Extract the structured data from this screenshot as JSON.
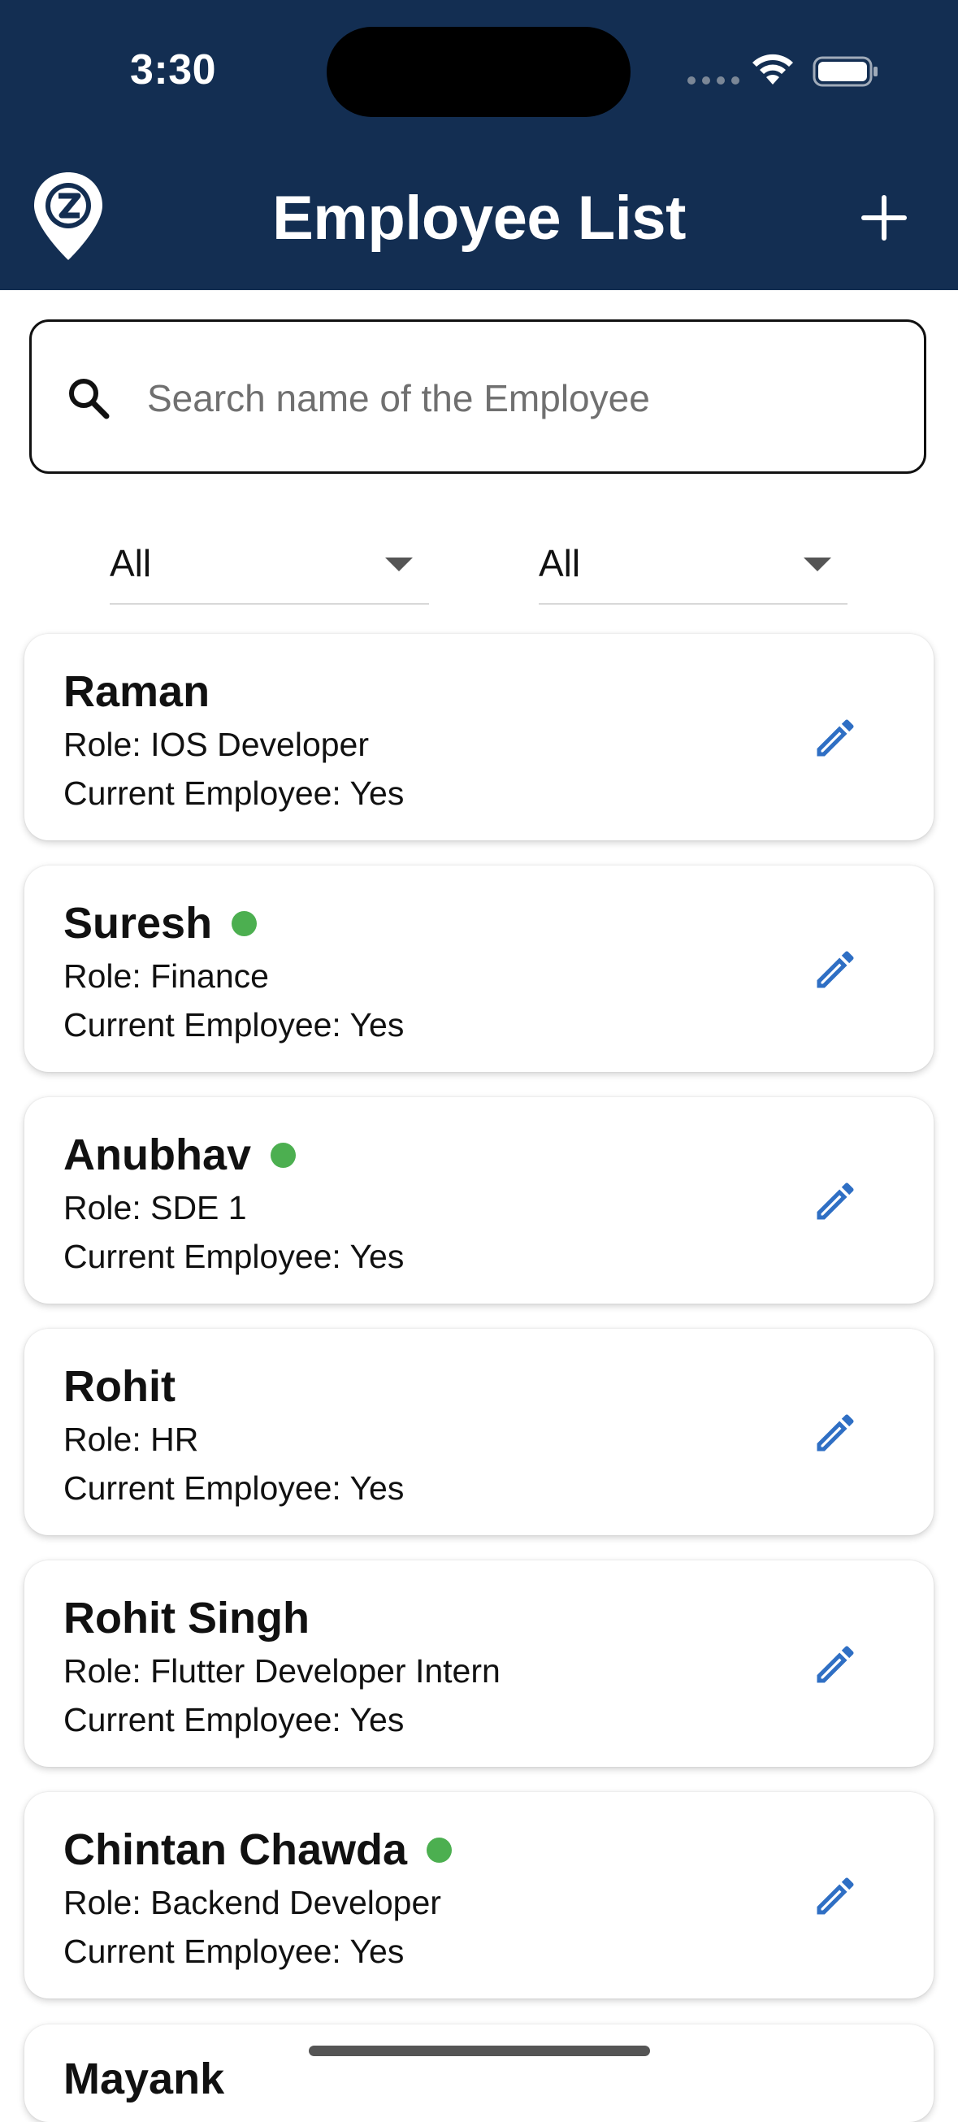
{
  "status_bar": {
    "time": "3:30"
  },
  "header": {
    "title": "Employee List",
    "logo_icon": "location-pin-z-logo",
    "add_icon": "plus-icon"
  },
  "search": {
    "placeholder": "Search name of the Employee",
    "value": ""
  },
  "filters": [
    {
      "selected": "All"
    },
    {
      "selected": "All"
    }
  ],
  "employees": [
    {
      "name": "Raman",
      "online": false,
      "role": "Role: IOS Developer",
      "current": "Current Employee: Yes"
    },
    {
      "name": "Suresh",
      "online": true,
      "role": "Role: Finance",
      "current": "Current Employee: Yes"
    },
    {
      "name": "Anubhav",
      "online": true,
      "role": "Role: SDE 1",
      "current": "Current Employee: Yes"
    },
    {
      "name": "Rohit",
      "online": false,
      "role": "Role: HR",
      "current": "Current Employee: Yes"
    },
    {
      "name": "Rohit Singh",
      "online": false,
      "role": "Role: Flutter Developer Intern",
      "current": "Current Employee: Yes"
    },
    {
      "name": "Chintan Chawda",
      "online": true,
      "role": "Role: Backend Developer",
      "current": "Current Employee: Yes"
    },
    {
      "name": "Mayank"
    }
  ],
  "colors": {
    "header_bg": "#132e52",
    "online_dot": "#4caf50",
    "edit_icon": "#2f6fc4"
  }
}
